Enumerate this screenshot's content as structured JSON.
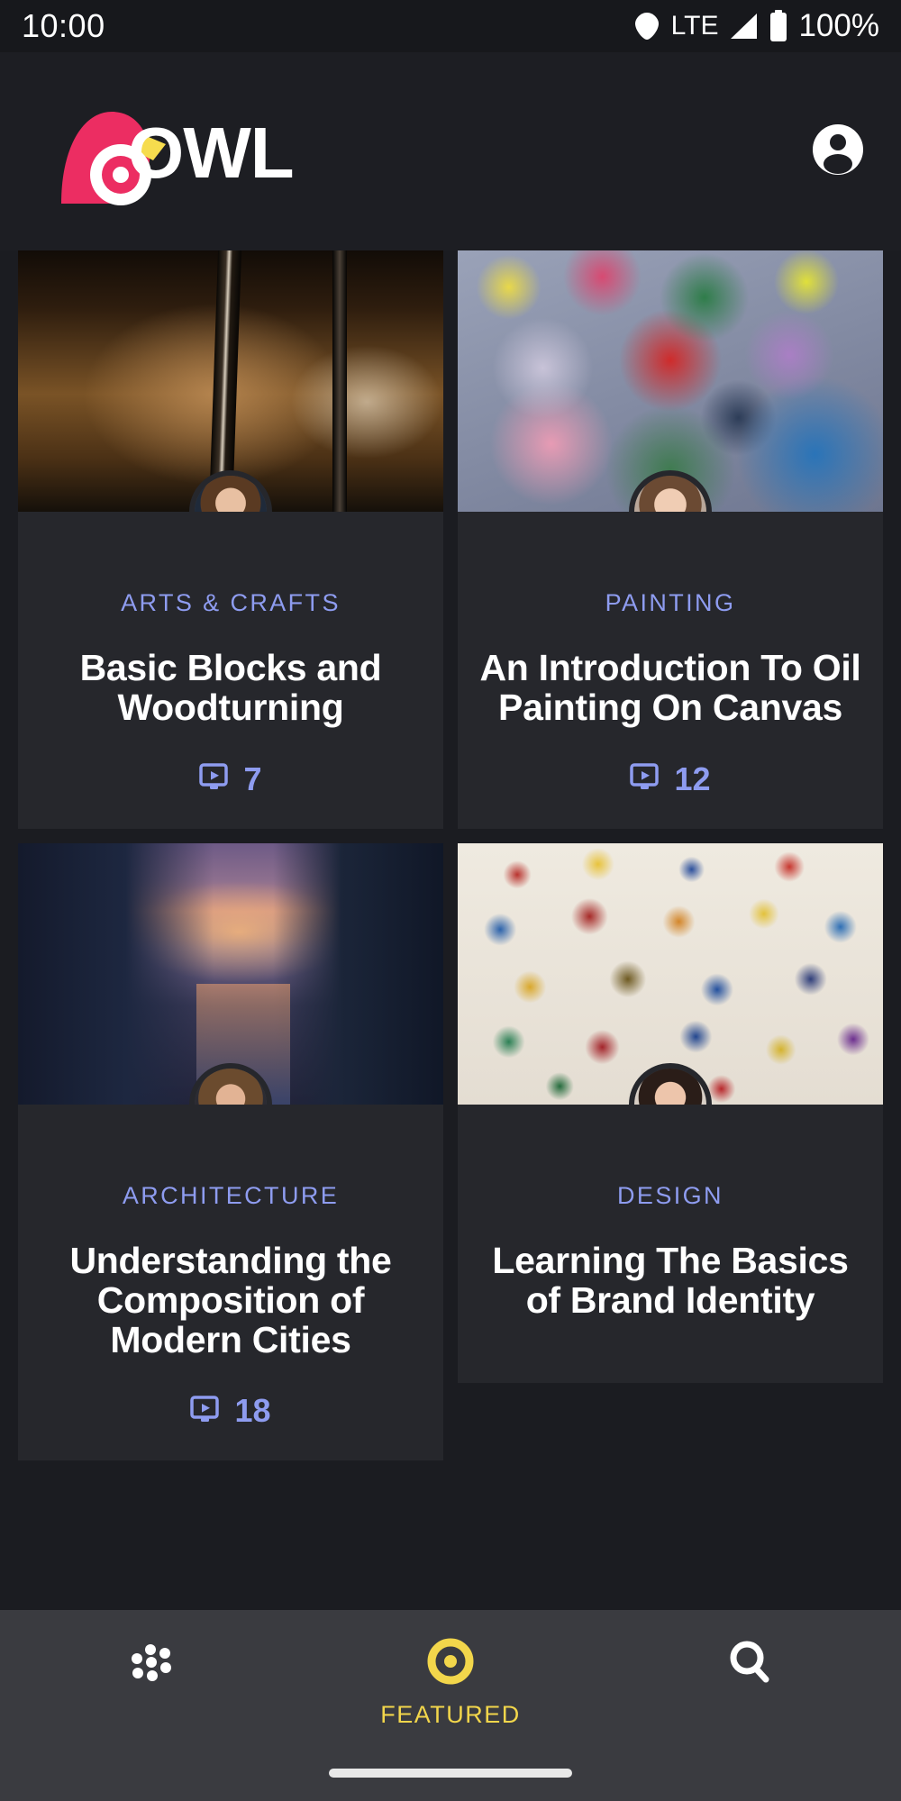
{
  "status_bar": {
    "time": "10:00",
    "network_label": "LTE",
    "battery_percent": "100%",
    "icons": [
      "wifi-icon",
      "signal-icon",
      "battery-icon"
    ]
  },
  "app_bar": {
    "logo_word": "OWL",
    "logo_colors": {
      "bird": "#ec2d62",
      "beak": "#f6dc4e",
      "word": "#ffffff"
    },
    "account_icon": "account-circle-icon"
  },
  "theme": {
    "page_background": "#1b1c21",
    "card_background": "#26272c",
    "category_color": "#8e9cf0",
    "accent_yellow": "#f2d64b",
    "title_color": "#ffffff"
  },
  "cards": [
    {
      "category": "ARTS & CRAFTS",
      "title": "Basic Blocks and Woodturning",
      "lesson_count": "7",
      "lesson_icon": "video-lesson-icon",
      "thumbnail": "drill-bit-on-wood-photo",
      "avatar": "author-avatar-male-brown-hair"
    },
    {
      "category": "PAINTING",
      "title": "An Introduction To Oil Painting On Canvas",
      "lesson_count": "12",
      "lesson_icon": "video-lesson-icon",
      "thumbnail": "oil-paint-palette-photo",
      "avatar": "author-avatar-female-dark-hair"
    },
    {
      "category": "ARCHITECTURE",
      "title": "Understanding the Composition of Modern Cities",
      "lesson_count": "18",
      "lesson_icon": "video-lesson-icon",
      "thumbnail": "city-skyline-at-dusk-photo",
      "avatar": "author-avatar-female-smiling"
    },
    {
      "category": "DESIGN",
      "title": "Learning The Basics of Brand Identity",
      "lesson_count": "",
      "lesson_icon": "video-lesson-icon",
      "thumbnail": "embroidered-patches-wall-photo",
      "avatar": "author-avatar-female-short-hair"
    }
  ],
  "bottom_nav": {
    "items": [
      {
        "label": "",
        "icon": "dots-grid-icon",
        "active": false
      },
      {
        "label": "FEATURED",
        "icon": "owl-eye-icon",
        "active": true
      },
      {
        "label": "",
        "icon": "search-icon",
        "active": false
      }
    ]
  }
}
